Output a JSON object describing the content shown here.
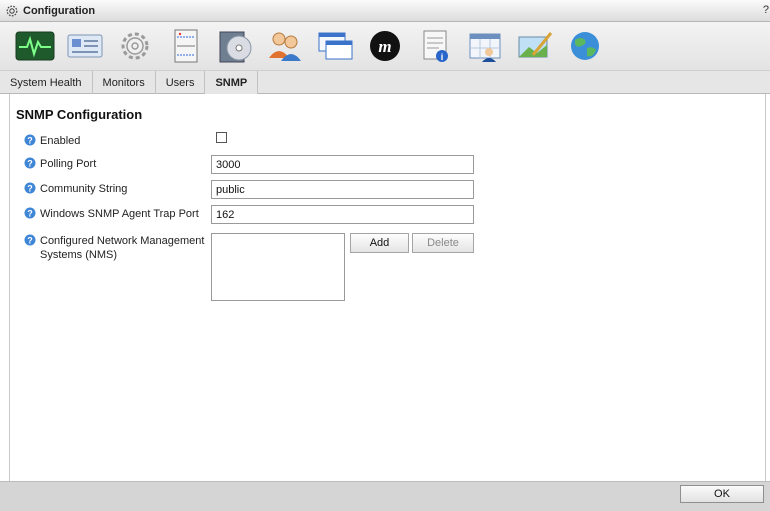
{
  "window": {
    "title": "Configuration",
    "help": "?"
  },
  "toolbar": {
    "icons": [
      "system-health-icon",
      "id-card-icon",
      "gear-icon",
      "server-icon",
      "disc-install-icon",
      "users-icon",
      "windows-icon",
      "m-logo-icon",
      "report-info-icon",
      "calendar-user-icon",
      "image-edit-icon",
      "globe-icon"
    ]
  },
  "tabs": [
    {
      "label": "System Health"
    },
    {
      "label": "Monitors"
    },
    {
      "label": "Users"
    },
    {
      "label": "SNMP",
      "active": true
    }
  ],
  "snmp": {
    "section_title": "SNMP Configuration",
    "enabled_label": "Enabled",
    "enabled": false,
    "polling_port_label": "Polling Port",
    "polling_port": "3000",
    "community_label": "Community String",
    "community": "public",
    "trap_port_label": "Windows SNMP Agent Trap Port",
    "trap_port": "162",
    "nms_label_line1": "Configured Network Management",
    "nms_label_line2": "Systems (NMS)",
    "nms_list": [],
    "add_label": "Add",
    "delete_label": "Delete"
  },
  "footer": {
    "ok_label": "OK"
  },
  "colors": {
    "help_icon": "#3f86d6",
    "health_icon_bg": "#2f6f3a",
    "footer_bg": "#d5d5d5"
  }
}
